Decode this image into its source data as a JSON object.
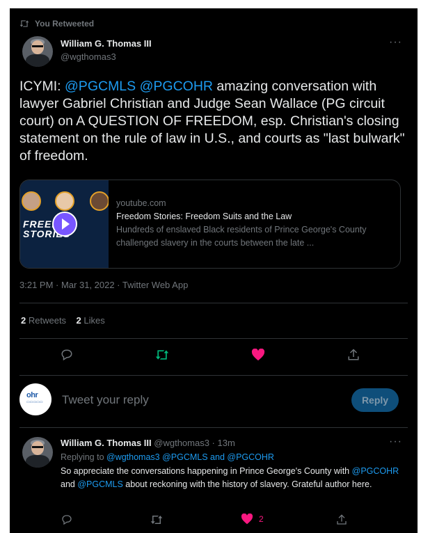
{
  "retweet": {
    "label": "You Retweeted"
  },
  "main": {
    "author_name": "William G. Thomas III",
    "handle": "@wgthomas3",
    "text_pre": "ICYMI:  ",
    "mention1": "@PGCMLS",
    "mention2": "@PGCOHR",
    "text_post": " amazing conversation with lawyer Gabriel Christian and Judge Sean Wallace (PG circuit court) on A QUESTION OF FREEDOM, esp. Christian's closing statement on the rule of law in U.S., and courts as \"last bulwark\" of freedom.",
    "more": "···"
  },
  "card": {
    "domain": "youtube.com",
    "title": "Freedom Stories: Freedom Suits and the Law",
    "description": "Hundreds of enslaved Black residents of Prince George's County challenged slavery in the courts between the late ...",
    "thumb_text": "FREEDOM STORIES"
  },
  "meta": {
    "timestamp": "3:21 PM · Mar 31, 2022 · Twitter Web App"
  },
  "stats": {
    "retweets_count": "2",
    "retweets_label": "Retweets",
    "likes_count": "2",
    "likes_label": "Likes"
  },
  "reply_box": {
    "avatar_text": "ohr",
    "placeholder": "Tweet your reply",
    "button": "Reply"
  },
  "reply_tweet": {
    "author_name": "William G. Thomas III",
    "handle_time": "@wgthomas3 · 13m",
    "replying_prefix": "Replying to ",
    "replying_handles": "@wgthomas3 @PGCMLS and @PGCOHR",
    "text_1": "So appreciate the conversations happening in Prince George's County with ",
    "mention1": "@PGCOHR",
    "text_2": " and ",
    "mention2": "@PGCMLS",
    "text_3": " about reckoning with the history of slavery. Grateful author here.",
    "likes": "2",
    "more": "···"
  },
  "colors": {
    "accent": "#1d9bf0",
    "retweet_green": "#00ba7c",
    "like_pink": "#f91880",
    "background": "#000000"
  }
}
